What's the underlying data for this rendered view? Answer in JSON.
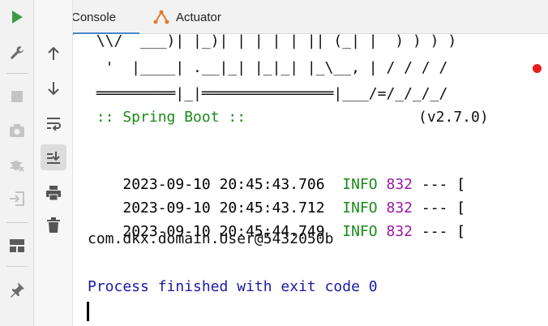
{
  "tabs": [
    {
      "label": "Console",
      "icon": "console-icon"
    },
    {
      "label": "Actuator",
      "icon": "actuator-icon"
    }
  ],
  "left_toolbar": [
    "run-icon",
    "wrench-icon",
    "stop-icon",
    "camera-icon",
    "debug-icon",
    "login-icon",
    "layout-icon",
    "pin-icon"
  ],
  "inner_toolbar": [
    "arrow-up-icon",
    "arrow-down-icon",
    "soft-wrap-icon",
    "scroll-to-end-icon",
    "print-icon",
    "trash-icon"
  ],
  "banner": {
    "line1": " \\\\/  ___)| |_)| | | | | || (_| |  ) ) ) )",
    "line2": "  '  |____| .__|_| |_|_| |_\\__, | / / / /",
    "line3": " ═════════|_|═══════════════|___/=/_/_/_/",
    "label": " :: Spring Boot ::",
    "version": "(v2.7.0)"
  },
  "logs": [
    {
      "timestamp": "2023-09-10 20:45:43.706",
      "level": "INFO",
      "pid": "832",
      "rest": "--- ["
    },
    {
      "timestamp": "2023-09-10 20:45:43.712",
      "level": "INFO",
      "pid": "832",
      "rest": "--- ["
    },
    {
      "timestamp": "2023-09-10 20:45:44.749",
      "level": "INFO",
      "pid": "832",
      "rest": "--- ["
    }
  ],
  "output_line": "com.dkx.domain.User@5432050b",
  "exit_message": "Process finished with exit code 0",
  "colors": {
    "info": "#1a8a1a",
    "pid": "#9a1aa6",
    "exit": "#1a1aa6",
    "run": "#3d9b48",
    "error_dot": "#e81d1d"
  }
}
